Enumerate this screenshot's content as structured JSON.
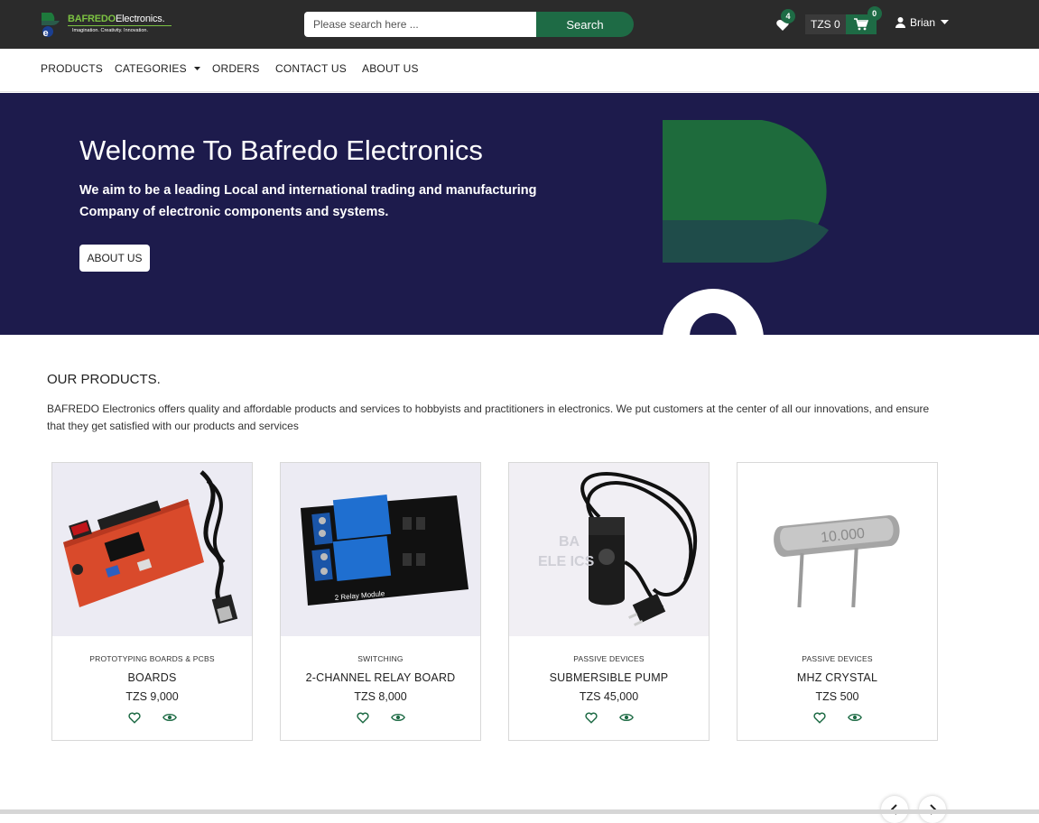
{
  "header": {
    "logo_brand_bold": "BAFREDO",
    "logo_brand_rest": "Electronics.",
    "logo_tagline": "Imagination. Creativity. Innovation.",
    "search_placeholder": "Please search here ...",
    "search_button": "Search",
    "wishlist_count": "4",
    "cart_total": "TZS 0",
    "cart_count": "0",
    "user_name": "Brian"
  },
  "nav": {
    "items": [
      "PRODUCTS",
      "CATEGORIES",
      "ORDERS",
      "CONTACT US",
      "ABOUT US"
    ]
  },
  "hero": {
    "title": "Welcome To Bafredo Electronics",
    "subtitle": "We aim to be a leading Local and international trading and manufacturing Company of electronic components and systems.",
    "button": "ABOUT US"
  },
  "products": {
    "title": "OUR PRODUCTS.",
    "description": "BAFREDO Electronics offers quality and affordable products and services to hobbyists and practitioners in electronics. We put customers at the center of all our innovations, and ensure that they get satisfied with our products and services",
    "items": [
      {
        "category": "PROTOTYPING BOARDS & PCBS",
        "name": "BOARDS",
        "price": "TZS 9,000",
        "image_icon": "dev-board-image"
      },
      {
        "category": "SWITCHING",
        "name": "2-CHANNEL RELAY BOARD",
        "price": "TZS 8,000",
        "image_icon": "relay-board-image"
      },
      {
        "category": "PASSIVE DEVICES",
        "name": "SUBMERSIBLE PUMP",
        "price": "TZS 45,000",
        "image_icon": "pump-image"
      },
      {
        "category": "PASSIVE DEVICES",
        "name": "MHZ CRYSTAL",
        "price": "TZS 500",
        "image_icon": "crystal-image"
      }
    ]
  },
  "colors": {
    "topbar": "#2b2b2b",
    "accent_green": "#1e6b45",
    "hero_bg": "#1d1b4c"
  }
}
